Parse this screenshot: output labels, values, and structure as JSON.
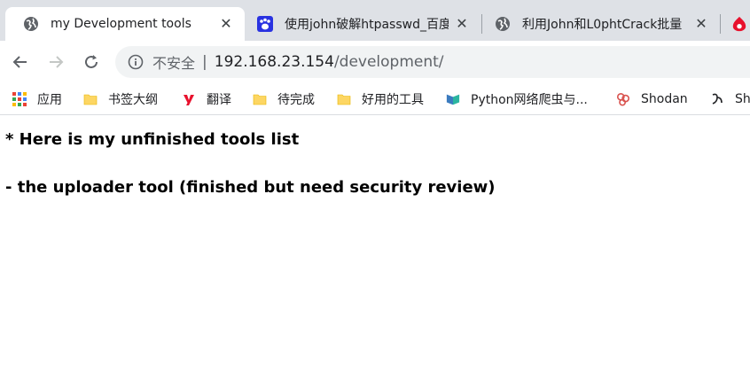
{
  "tabs": [
    {
      "title": "my Development tools",
      "close": "✕"
    },
    {
      "title": "使用john破解htpasswd_百度",
      "close": "✕"
    },
    {
      "title": "利用John和L0phtCrack批量",
      "close": "✕"
    }
  ],
  "address": {
    "insecure_label": "不安全",
    "separator": "|",
    "host": "192.168.23.154",
    "path": "/development/"
  },
  "bookmarks": [
    {
      "label": "应用",
      "icon": "apps-grid-icon"
    },
    {
      "label": "书签大纲",
      "icon": "folder-icon"
    },
    {
      "label": "翻译",
      "icon": "youdao-icon"
    },
    {
      "label": "待完成",
      "icon": "folder-icon"
    },
    {
      "label": "好用的工具",
      "icon": "folder-icon"
    },
    {
      "label": "Python网络爬虫与...",
      "icon": "python-icon"
    },
    {
      "label": "Shodan",
      "icon": "shodan-icon"
    },
    {
      "label": "Sh",
      "icon": "bookmark-icon"
    }
  ],
  "content": {
    "line1": "* Here is my unfinished tools list",
    "line2": "- the uploader tool (finished but need security review)"
  },
  "colors": {
    "tabstrip": "#dee1e6",
    "omnibox": "#f1f3f4",
    "folder": "#fdd663",
    "baidu": "#2932e1",
    "youdao": "#e8112d"
  }
}
